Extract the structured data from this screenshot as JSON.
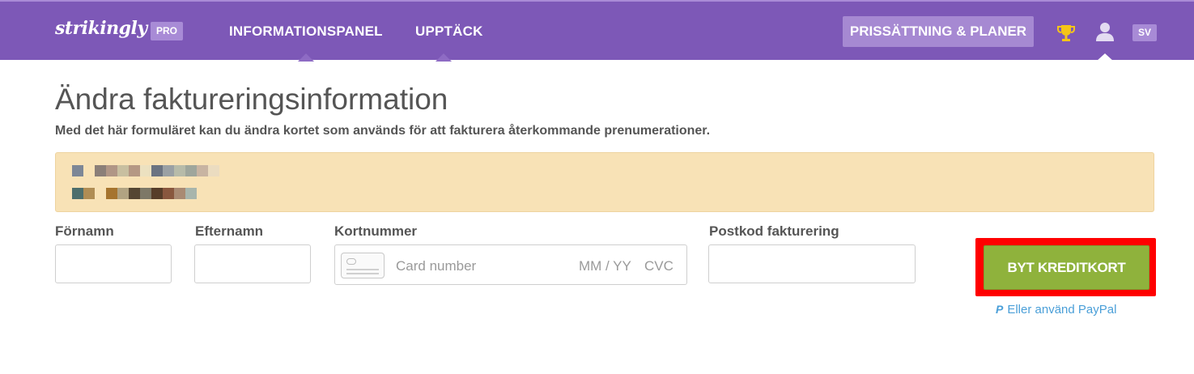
{
  "nav": {
    "logo": "strikingly",
    "pro_badge": "PRO",
    "links": [
      "INFORMATIONSPANEL",
      "UPPTÄCK"
    ],
    "pricing_button": "PRISSÄTTNING & PLANER",
    "trophy_icon": "trophy-icon",
    "user_icon": "user-icon",
    "language": "SV",
    "colors": {
      "bar": "#7d58b7",
      "badge": "#a88bd6",
      "trophy": "#f5c518"
    }
  },
  "main": {
    "title": "Ändra faktureringsinformation",
    "subtitle": "Med det här formuläret kan du ändra kortet som används för att fakturera återkommande prenumerationer.",
    "notice": {
      "row1_colors": [
        "#7d8796",
        "#f8e2b6",
        "#8b7f78",
        "#b09686",
        "#c8bfa0",
        "#b59884",
        "#ece1c0",
        "#6b7381",
        "#9aa0a4",
        "#b7bba9",
        "#9fa69c",
        "#c8b4a2",
        "#ebdcc0"
      ],
      "row2_colors": [
        "#4d6e6c",
        "#b08d54",
        "#f8e2b6",
        "#a6742e",
        "#b1a382",
        "#554633",
        "#7d7867",
        "#563d29",
        "#89573e",
        "#a98a73",
        "#a8b5ac"
      ]
    },
    "form": {
      "first_name_label": "Förnamn",
      "last_name_label": "Efternamn",
      "card_number_label": "Kortnummer",
      "card_number_placeholder": "Card number",
      "card_expiry_placeholder": "MM / YY",
      "card_cvc_placeholder": "CVC",
      "postcode_label": "Postkod fakturering",
      "submit_label": "BYT KREDITKORT",
      "paypal_logo": "P",
      "paypal_label": "Eller använd PayPal",
      "colors": {
        "submit": "#8fb23c",
        "highlight": "#ff0000",
        "link": "#4a9fd8"
      }
    }
  }
}
